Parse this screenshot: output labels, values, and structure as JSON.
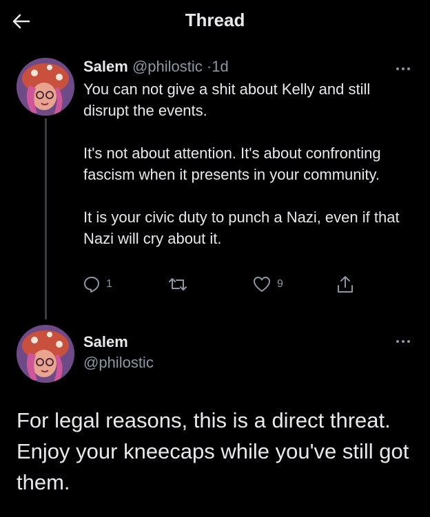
{
  "header": {
    "title": "Thread",
    "back_icon": "arrow-left-icon"
  },
  "tweet1": {
    "name": "Salem",
    "handle": "@philostic",
    "separator": "·",
    "time": "1d",
    "paragraphs": [
      "You can not give a shit about Kelly and still disrupt the events.",
      "It's not about attention. It's about confronting fascism when it presents in your community.",
      "It is your civic duty to punch a Nazi, even if that Nazi will cry about it."
    ],
    "reply_count": "1",
    "like_count": "9",
    "icons": [
      "reply-icon",
      "retweet-icon",
      "like-icon",
      "share-icon",
      "more-icon"
    ]
  },
  "tweet2": {
    "name": "Salem",
    "handle": "@philostic",
    "body": "For legal reasons, this is a direct threat. Enjoy your kneecaps while you've still got them."
  },
  "colors": {
    "background": "#000000",
    "text": "#e7e9ea",
    "muted": "#8b98a5",
    "thread_line": "#3a3d40"
  }
}
